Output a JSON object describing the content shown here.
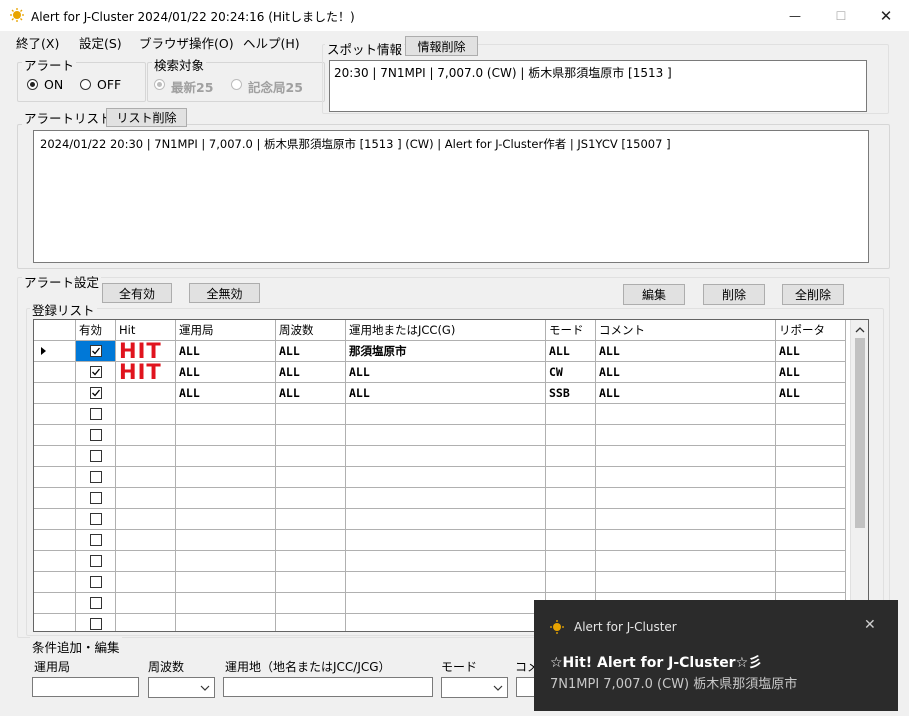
{
  "window": {
    "title": "Alert for J-Cluster  2024/01/22 20:24:16 (Hitしました！)",
    "minimize_glyph": "—",
    "maximize_glyph": "☐",
    "close_glyph": "✕"
  },
  "menu": [
    "終了(X)",
    "設定(S)",
    "ブラウザ操作(O)",
    "ヘルプ(H)"
  ],
  "alert_group": {
    "label": "アラート",
    "on_label": "ON",
    "off_label": "OFF",
    "selected": "ON"
  },
  "search_group": {
    "label": "検索対象",
    "opt1": "最新25",
    "opt2": "記念局25",
    "selected": "最新25"
  },
  "spot": {
    "label": "スポット情報",
    "clear_button": "情報削除",
    "text": "20:30 | 7N1MPI | 7,007.0 (CW) | 栃木県那須塩原市 [1513 ]"
  },
  "alert_list": {
    "label": "アラートリスト",
    "clear_button": "リスト削除",
    "text": "2024/01/22 20:30 | 7N1MPI | 7,007.0 | 栃木県那須塩原市 [1513 ] (CW) | Alert for J-Cluster作者 | JS1YCV [15007 ]"
  },
  "alert_settings": {
    "label": "アラート設定",
    "enable_all": "全有効",
    "disable_all": "全無効",
    "edit": "編集",
    "delete": "削除",
    "delete_all": "全削除",
    "list_label": "登録リスト"
  },
  "grid": {
    "headers": [
      "有効",
      "Hit",
      "運用局",
      "周波数",
      "運用地またはJCC(G)",
      "モード",
      "コメント",
      "リポータ"
    ],
    "rows": [
      {
        "enabled": true,
        "hit": "HIT",
        "station": "ALL",
        "freq": "ALL",
        "location": "那須塩原市",
        "mode": "ALL",
        "comment": "ALL",
        "reporter": "ALL",
        "current": true
      },
      {
        "enabled": true,
        "hit": "HIT",
        "station": "ALL",
        "freq": "ALL",
        "location": "ALL",
        "mode": "CW",
        "comment": "ALL",
        "reporter": "ALL"
      },
      {
        "enabled": true,
        "hit": "",
        "station": "ALL",
        "freq": "ALL",
        "location": "ALL",
        "mode": "SSB",
        "comment": "ALL",
        "reporter": "ALL"
      },
      {
        "enabled": false
      },
      {
        "enabled": false
      },
      {
        "enabled": false
      },
      {
        "enabled": false
      },
      {
        "enabled": false
      },
      {
        "enabled": false
      },
      {
        "enabled": false
      },
      {
        "enabled": false
      },
      {
        "enabled": false
      },
      {
        "enabled": false
      },
      {
        "enabled": false
      }
    ]
  },
  "condition": {
    "label": "条件追加・編集",
    "station_label": "運用局",
    "freq_label": "周波数",
    "location_label": "運用地（地名またはJCC/JCG）",
    "mode_label": "モード",
    "comment_label": "コメ"
  },
  "toast": {
    "app": "Alert for J-Cluster",
    "title": "☆Hit! Alert for J-Cluster☆彡",
    "body": "7N1MPI  7,007.0 (CW)  栃木県那須塩原市",
    "close_glyph": "✕"
  }
}
